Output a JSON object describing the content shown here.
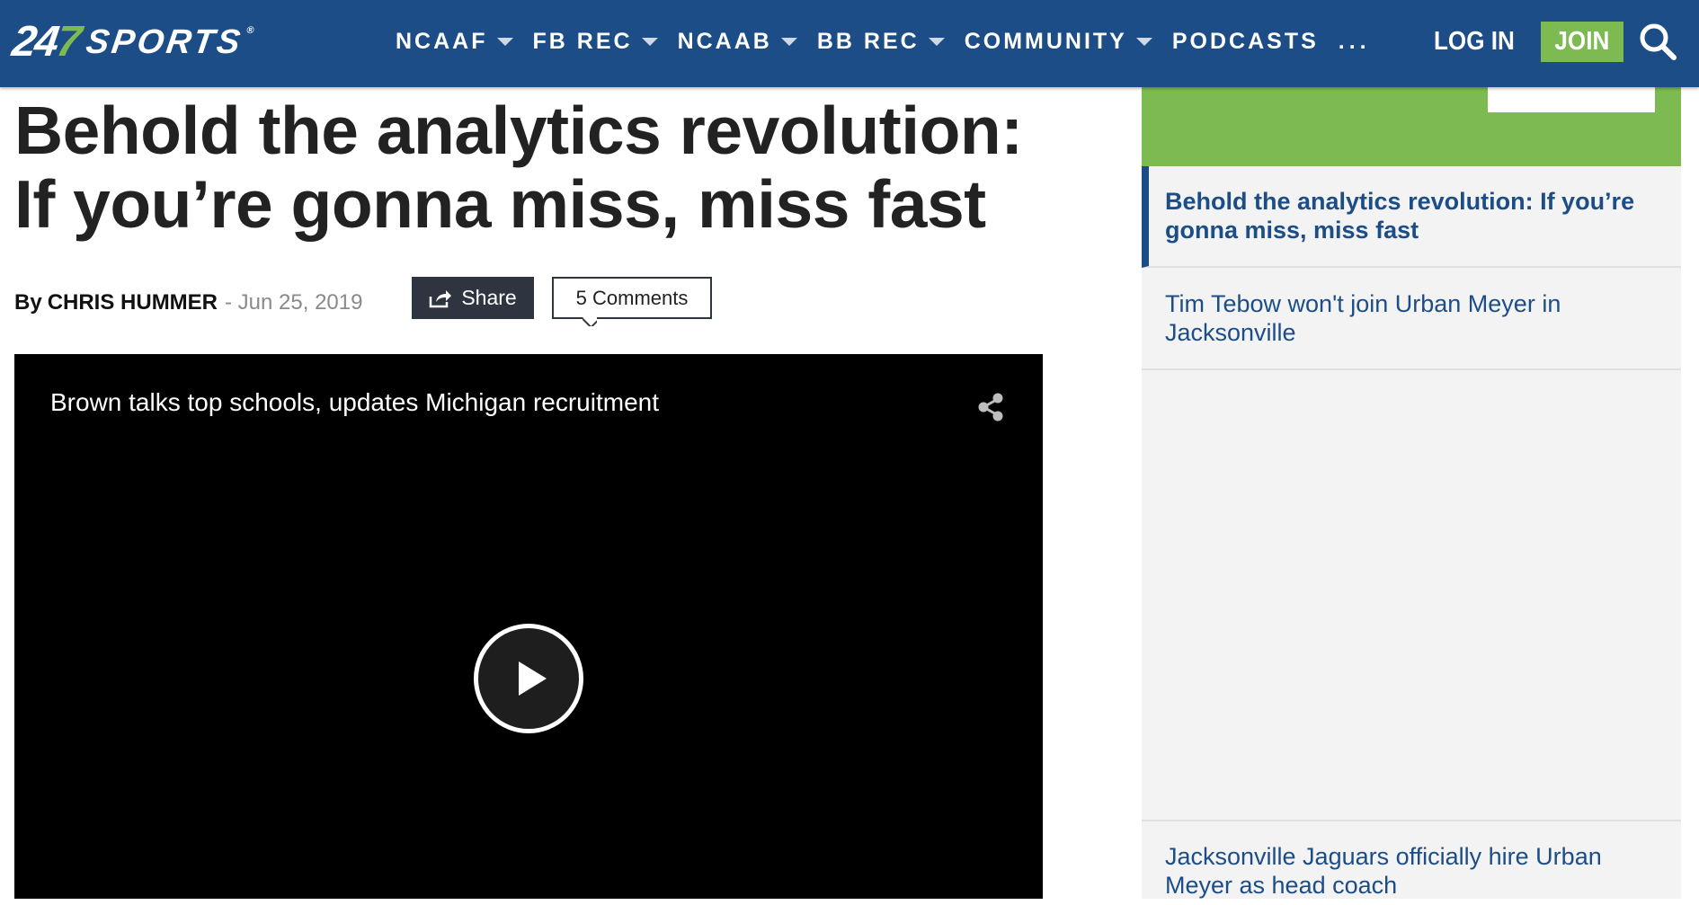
{
  "brand": {
    "logo_number": "24",
    "logo_seven": "7",
    "logo_word": "SPORTS",
    "logo_tm": "®"
  },
  "nav": {
    "items": [
      {
        "label": "NCAAF",
        "has_caret": true
      },
      {
        "label": "FB REC",
        "has_caret": true
      },
      {
        "label": "NCAAB",
        "has_caret": true
      },
      {
        "label": "BB REC",
        "has_caret": true
      },
      {
        "label": "COMMUNITY",
        "has_caret": true
      },
      {
        "label": "PODCASTS",
        "has_caret": false
      }
    ],
    "more_label": "...",
    "login_label": "LOG IN",
    "join_label": "JOIN",
    "search_icon": "search-icon",
    "colors": {
      "bar": "#1c4d87",
      "join": "#7dba52"
    }
  },
  "article": {
    "headline_line1": "Behold the analytics revolution:",
    "headline_line2": "If you’re gonna miss, miss fast",
    "by_label": "By",
    "author": "CHRIS HUMMER",
    "date": "- Jun 25, 2019",
    "share_label": "Share",
    "comments_label": "5 Comments"
  },
  "video": {
    "title": "Brown talks top schools, updates Michigan recruitment",
    "share_icon": "share-icon",
    "play_icon": "play-icon"
  },
  "sidebar": {
    "items": [
      {
        "label": "Behold the analytics revolution: If you’re gonna miss, miss fast",
        "active": true
      },
      {
        "label": "Tim Tebow won't join Urban Meyer in Jacksonville",
        "active": false
      },
      {
        "label": "Jacksonville Jaguars officially hire Urban Meyer as head coach",
        "active": false
      }
    ]
  }
}
